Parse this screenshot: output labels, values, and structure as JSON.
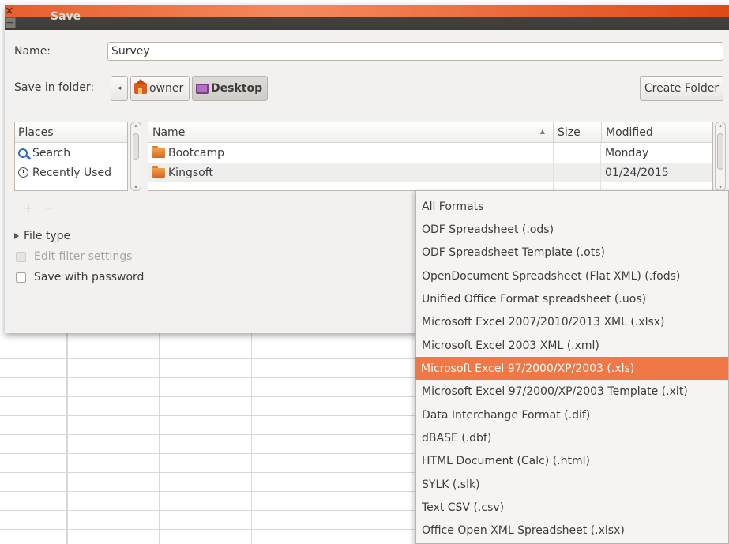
{
  "window": {
    "title": "Save",
    "close_glyph": "×",
    "min_glyph": "−"
  },
  "name_row": {
    "label": "Name:",
    "value": "Survey"
  },
  "folder_row": {
    "label": "Save in folder:",
    "back_glyph": "◂",
    "path": [
      {
        "label": "owner",
        "icon": "home-folder-icon"
      },
      {
        "label": "Desktop",
        "icon": "desktop-folder-icon"
      }
    ],
    "create_folder_label": "Create Folder"
  },
  "places": {
    "header": "Places",
    "items": [
      {
        "label": "Search",
        "icon": "search-icon"
      },
      {
        "label": "Recently Used",
        "icon": "clock-icon"
      }
    ],
    "add_glyph": "+",
    "remove_glyph": "−"
  },
  "files": {
    "columns": {
      "name": "Name",
      "sort_glyph": "▲",
      "size": "Size",
      "modified": "Modified"
    },
    "rows": [
      {
        "name": "Bootcamp",
        "size": "",
        "modified": "Monday"
      },
      {
        "name": "Kingsoft",
        "size": "",
        "modified": "01/24/2015"
      }
    ]
  },
  "file_type_label": "File type",
  "edit_filter_label": "Edit filter settings",
  "save_password_label": "Save with password",
  "format_menu": {
    "selected_index": 7,
    "items": [
      "All Formats",
      "ODF Spreadsheet (.ods)",
      "ODF Spreadsheet Template (.ots)",
      "OpenDocument Spreadsheet (Flat XML) (.fods)",
      "Unified Office Format spreadsheet (.uos)",
      "Microsoft Excel 2007/2010/2013 XML (.xlsx)",
      "Microsoft Excel 2003 XML (.xml)",
      "Microsoft Excel 97/2000/XP/2003 (.xls)",
      "Microsoft Excel 97/2000/XP/2003 Template (.xlt)",
      "Data Interchange Format (.dif)",
      "dBASE (.dbf)",
      "HTML Document (Calc) (.html)",
      "SYLK (.slk)",
      "Text CSV (.csv)",
      "Office Open XML Spreadsheet (.xlsx)"
    ]
  },
  "colors": {
    "menu_highlight": "#f07746",
    "title_bar": "#3c3b37",
    "dialog_bg": "#f2f1f0"
  }
}
